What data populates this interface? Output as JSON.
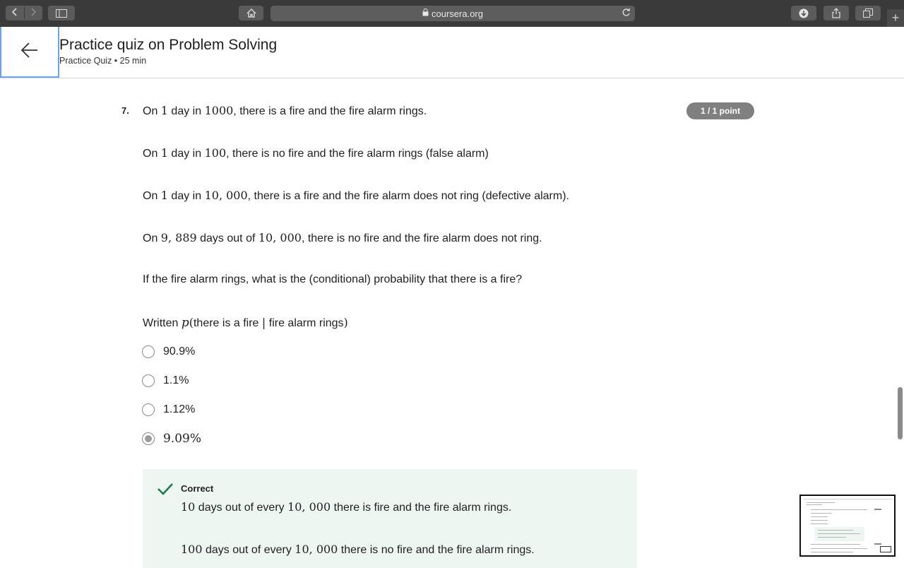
{
  "browser": {
    "url": "coursera.org",
    "icons": {
      "back": "chevron-left-icon",
      "forward": "chevron-right-icon",
      "sidebar": "sidebar-icon",
      "home": "home-icon",
      "lock": "lock-icon",
      "reload": "reload-icon",
      "download": "download-icon",
      "share": "share-icon",
      "tabs": "tabs-icon",
      "new_tab": "plus-icon"
    }
  },
  "header": {
    "title": "Practice quiz on Problem Solving",
    "subtitle": "Practice Quiz • 25 min",
    "back_icon": "arrow-left-icon"
  },
  "question": {
    "number": "7.",
    "points": "1 / 1 point",
    "lines": [
      {
        "pre": "On ",
        "m1": "1",
        "mid": " day in ",
        "m2": "1000",
        "post": ", there is a fire and the fire alarm rings."
      },
      {
        "pre": "On ",
        "m1": "1",
        "mid": " day in ",
        "m2": "100",
        "post": ", there is no fire and the fire alarm rings (false alarm)"
      },
      {
        "pre": "On ",
        "m1": "1",
        "mid": " day in ",
        "m2": "10, 000",
        "post": ", there is a fire and the fire alarm does not ring (defective alarm)."
      },
      {
        "pre": "On ",
        "m1": "9, 889",
        "mid": " days out of ",
        "m2": "10, 000",
        "post": ", there is no fire and the fire alarm does not ring."
      }
    ],
    "prompt": "If the fire alarm rings, what is the (conditional) probability that there is a fire?",
    "written": {
      "pre": "Written ",
      "p": "p",
      "paren_open": "(",
      "text": "there is a fire ",
      "bar": "|",
      "text2": " fire alarm rings",
      "paren_close": ")"
    },
    "options": [
      {
        "label": "90.9%",
        "selected": false
      },
      {
        "label": "1.1%",
        "selected": false
      },
      {
        "label": "1.12%",
        "selected": false
      },
      {
        "label": "9.09%",
        "selected": true
      }
    ]
  },
  "feedback": {
    "status": "Correct",
    "icon": "checkmark-icon",
    "color": "#1d7a4f",
    "lines": [
      {
        "m1": "10",
        "mid": " days out of every ",
        "m2": "10, 000",
        "post": " there is fire and the fire alarm rings."
      },
      {
        "m1": "100",
        "mid": " days out of every ",
        "m2": "10, 000",
        "post": " there is no fire and the fire alarm rings."
      }
    ]
  }
}
